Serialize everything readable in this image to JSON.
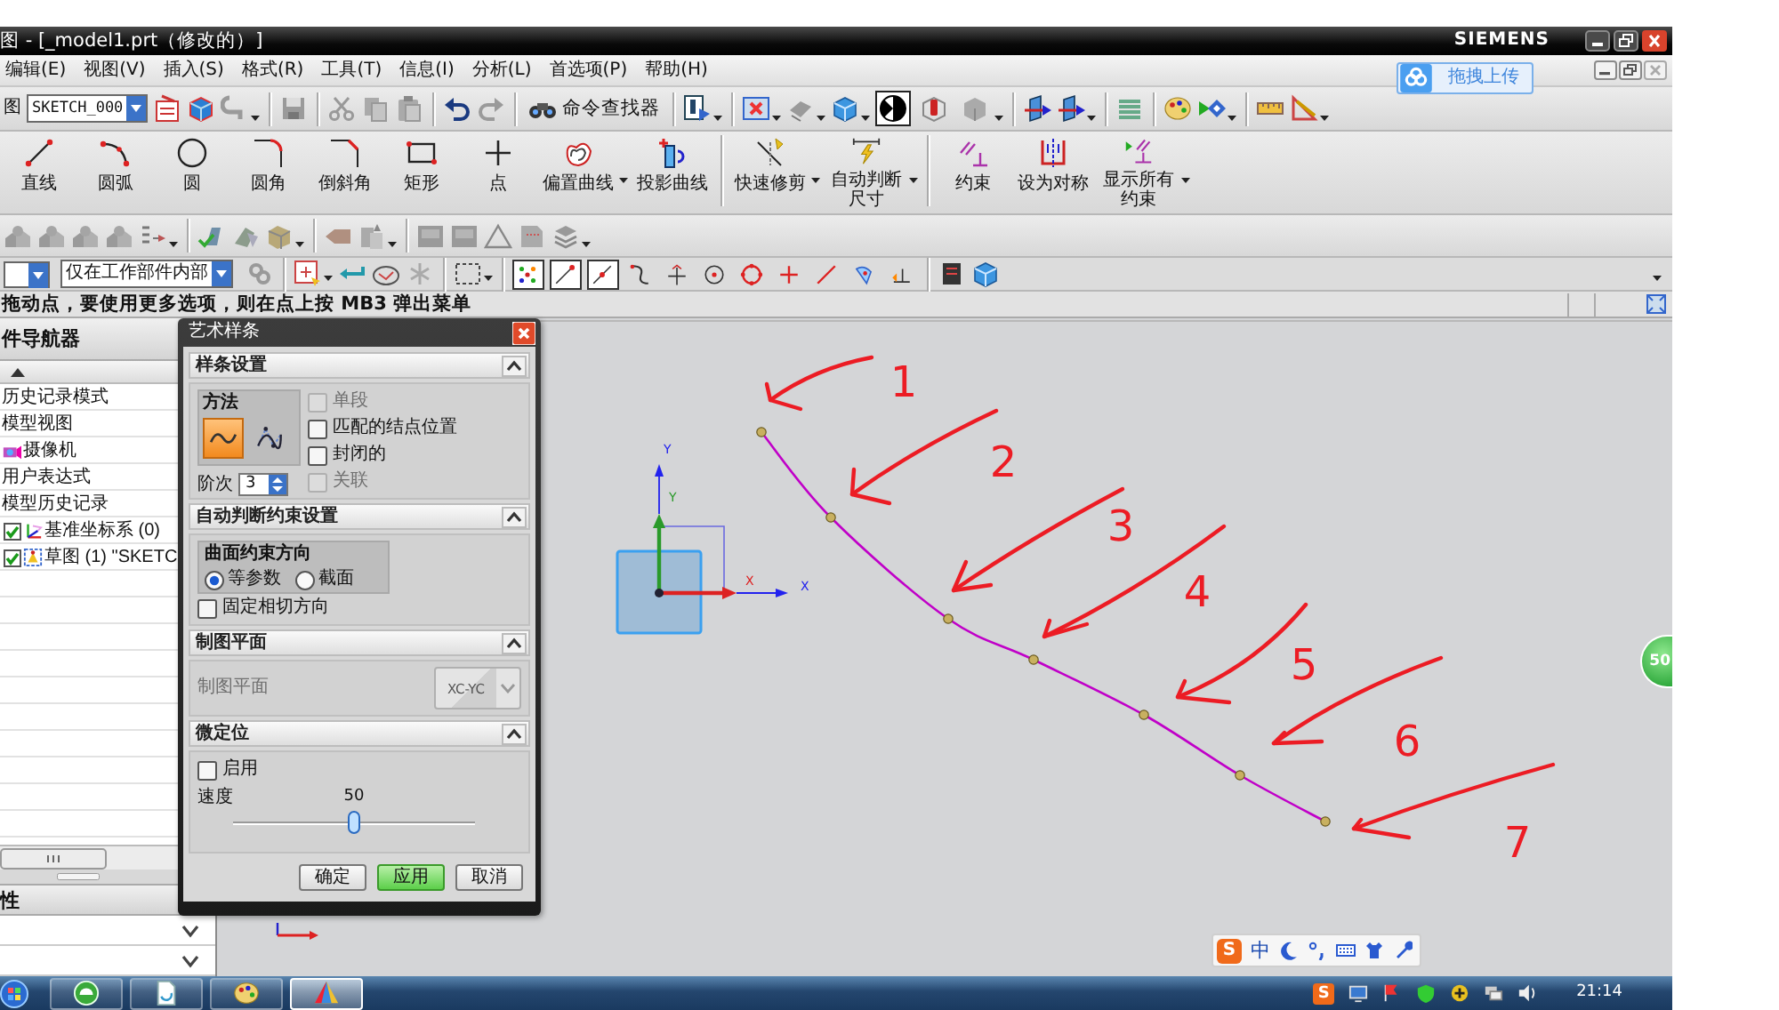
{
  "window": {
    "title": "图 - [_model1.prt（修改的）]",
    "brand": "SIEMENS"
  },
  "menu": [
    "编辑(E)",
    "视图(V)",
    "插入(S)",
    "格式(R)",
    "工具(T)",
    "信息(I)",
    "分析(L)",
    "首选项(P)",
    "帮助(H)"
  ],
  "upload_button": {
    "label": "拖拽上传"
  },
  "standard_toolbar": {
    "label": "图",
    "sketch_name": "SKETCH_000",
    "command_finder": "命令查找器",
    "render_styles": [
      {
        "selected": true
      },
      {
        "selected": false
      },
      {
        "selected": false
      }
    ]
  },
  "sketch_tools": [
    {
      "label": "直线"
    },
    {
      "label": "圆弧"
    },
    {
      "label": "圆"
    },
    {
      "label": "圆角"
    },
    {
      "label": "倒斜角"
    },
    {
      "label": "矩形"
    },
    {
      "label": "点"
    },
    {
      "label": "偏置曲线"
    },
    {
      "label": "投影曲线"
    },
    {
      "label": "快速修剪"
    },
    {
      "label": "自动判断尺寸"
    },
    {
      "label": "约束"
    },
    {
      "label": "设为对称"
    },
    {
      "label": "显示所有约束"
    }
  ],
  "selection_bar": {
    "scope": "仅在工作部件内部",
    "snap_points": [
      {
        "selected": true
      },
      {
        "selected": true
      },
      {
        "selected": true
      },
      {
        "selected": false
      },
      {
        "selected": false
      },
      {
        "selected": false
      },
      {
        "selected": false
      },
      {
        "selected": false
      },
      {
        "selected": false
      },
      {
        "selected": false
      },
      {
        "selected": false
      }
    ]
  },
  "status_bar": {
    "prompt": "拖动点，要使用更多选项，则在点上按 MB3 弹出菜单"
  },
  "part_navigator": {
    "title": "件导航器",
    "rows": [
      {
        "kind": "node",
        "label": "历史记录模式"
      },
      {
        "kind": "node",
        "label": "模型视图"
      },
      {
        "kind": "camera",
        "label": "摄像机"
      },
      {
        "kind": "node",
        "label": "用户表达式"
      },
      {
        "kind": "node",
        "label": "模型历史记录"
      },
      {
        "kind": "datum",
        "label": "基准坐标系 (0)",
        "checked": true
      },
      {
        "kind": "sketch",
        "label": "草图 (1) \"SKETC",
        "checked": true
      }
    ]
  },
  "properties_panel": {
    "title": "性"
  },
  "dialog": {
    "title": "艺术样条",
    "spline_settings": {
      "title": "样条设置",
      "expanded": true,
      "method_label": "方法",
      "methods": [
        {
          "selected": true
        },
        {
          "selected": false
        }
      ],
      "options": [
        {
          "label": "单段",
          "checked": false,
          "disabled": true
        },
        {
          "label": "匹配的结点位置",
          "checked": false,
          "disabled": false
        },
        {
          "label": "封闭的",
          "checked": false,
          "disabled": false
        },
        {
          "label": "关联",
          "checked": false,
          "disabled": true
        }
      ],
      "degree_label": "阶次",
      "degree": "3"
    },
    "constraint_settings": {
      "title": "自动判断约束设置",
      "expanded": true,
      "group_label": "曲面约束方向",
      "directions": [
        {
          "label": "等参数",
          "selected": true
        },
        {
          "label": "截面",
          "selected": false
        }
      ],
      "fixed_tangent": {
        "label": "固定相切方向",
        "checked": false
      }
    },
    "drawing_plane": {
      "title": "制图平面",
      "expanded": true,
      "label": "制图平面",
      "disabled": true,
      "plane": "XC-YC"
    },
    "fine_positioning": {
      "title": "微定位",
      "expanded": true,
      "enable": {
        "label": "启用",
        "checked": false
      },
      "speed_label": "速度",
      "speed_value": "50",
      "speed": {
        "level": 0.5
      }
    },
    "buttons": [
      {
        "label": "确定",
        "kind": "normal"
      },
      {
        "label": "应用",
        "kind": "default"
      },
      {
        "label": "取消",
        "kind": "normal"
      }
    ]
  },
  "canvas": {
    "axis_labels": [
      "Y",
      "Y",
      "X",
      "X"
    ],
    "annotations": [
      "1",
      "2",
      "3",
      "4",
      "5",
      "6",
      "7"
    ],
    "badge": "50"
  },
  "ime_bar": {
    "logo": "S",
    "mode": "中"
  },
  "taskbar": {
    "apps": [
      {
        "selected": false
      },
      {
        "selected": false
      },
      {
        "selected": false
      },
      {
        "selected": true
      }
    ],
    "tray_logo": "S",
    "clock": "21:14"
  }
}
